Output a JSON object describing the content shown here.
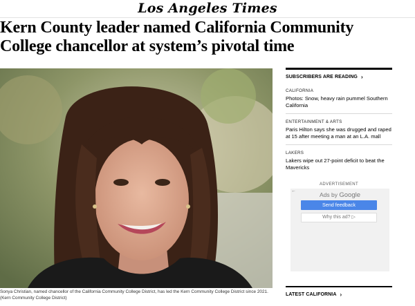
{
  "masthead": {
    "logo": "Los Angeles Times"
  },
  "article": {
    "headline": "Kern County leader named California Community College chancellor at system’s pivotal time",
    "photo_alt": "Sonya Christian portrait",
    "caption": "Sonya Christian, named chancellor of the California Community College District, has led the Kern Community College District since 2021. (Kern Community College District)"
  },
  "sidebar": {
    "section_title": "SUBSCRIBERS ARE READING",
    "stories": [
      {
        "kicker": "CALIFORNIA",
        "title": "Photos: Snow, heavy rain pummel Southern California"
      },
      {
        "kicker": "ENTERTAINMENT & ARTS",
        "title": "Paris Hilton says she was drugged and raped at 15 after meeting a man at an L.A. mall"
      },
      {
        "kicker": "LAKERS",
        "title": "Lakers wipe out 27-point deficit to beat the Mavericks"
      }
    ],
    "latest_title": "LATEST CALIFORNIA"
  },
  "ad": {
    "label": "ADVERTISEMENT",
    "ads_by": "Ads by",
    "google": "Google",
    "send_feedback": "Send feedback",
    "why_this_ad": "Why this ad?"
  },
  "icons": {
    "chevron": "chevron-right-icon",
    "back": "back-arrow-icon",
    "info": "info-triangle-icon"
  }
}
